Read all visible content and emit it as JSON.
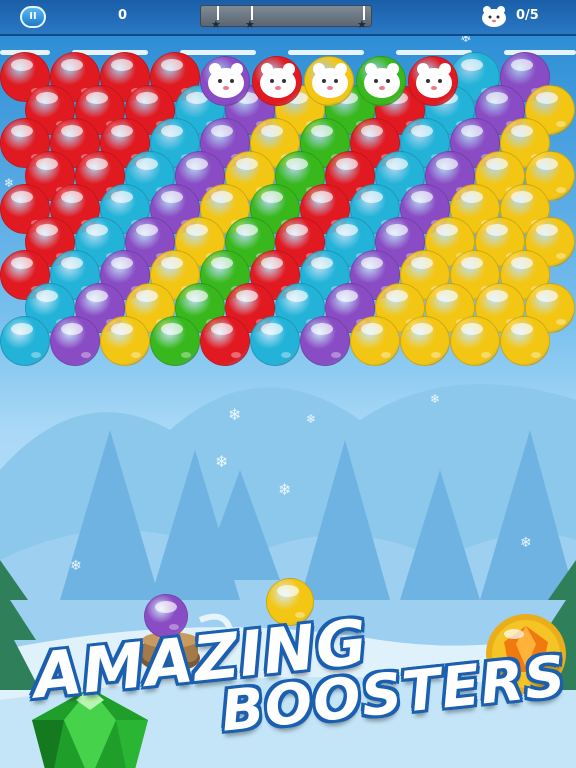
{
  "hud": {
    "pause_symbol": "II",
    "score": "0",
    "goal_progress": "0/5",
    "progress_fraction": 0.0
  },
  "banner": {
    "line1": "AMAZING",
    "line2": "BOOSTERS"
  },
  "colors": {
    "red": "#e11a22",
    "cyan": "#23b3d8",
    "purple": "#8a4cc4",
    "yellow": "#f4c614",
    "green": "#39b81e",
    "accent_blue": "#1a5fb0"
  },
  "grid_rows": [
    "RRRR.....CP",
    "RRRCPYGRCPY",
    "RRRCPYGRCPY",
    "RRCPYGRCPYY",
    "RRCPYGRCPYY",
    "RCPYGRCPYYY",
    "RCPYGRCPYYY",
    "CPYGRCPYYYY",
    "CPYGRCPYYYY"
  ],
  "bear_colors": [
    "purple",
    "red",
    "yellow",
    "green",
    "red"
  ],
  "shooter": {
    "current": "purple",
    "next": "yellow"
  },
  "boosters": {
    "left_gem": "green-gem-icon",
    "right_gem": "orange-gem-icon"
  }
}
